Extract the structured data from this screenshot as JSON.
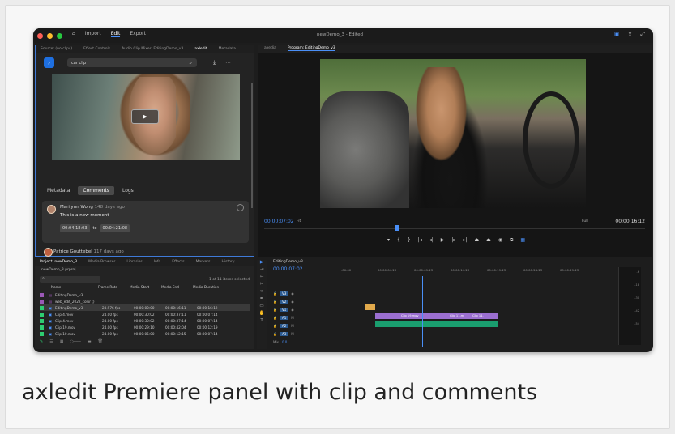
{
  "caption": "axledit Premiere panel with clip and comments",
  "titlebar": {
    "menu": [
      "Import",
      "Edit",
      "Export"
    ],
    "active_menu": "Edit",
    "doc_title": "newDemo_3 - Edited"
  },
  "left_panel": {
    "tabs": [
      "Source: (no clips)",
      "Effect Controls",
      "Audio Clip Mixer: EditingDemo_v3",
      "axledit",
      "Metadata"
    ],
    "active_tab": "axledit",
    "search_value": "car clip",
    "sub_tabs": [
      "Metadata",
      "Comments",
      "Logs"
    ],
    "active_sub_tab": "Comments",
    "comment": {
      "author": "Marilynn Wong",
      "age": "148 days ago",
      "text": "This is a new moment",
      "time_start": "00:04:18:03",
      "time_sep": "to",
      "time_end": "00:04:21:08"
    },
    "comment2": {
      "author": "Patrice Gouttebel",
      "age": "117 days ago"
    }
  },
  "program_panel": {
    "tabs": [
      "axedia",
      "Program: EditingDemo_v3"
    ],
    "active_tab": "Program: EditingDemo_v3",
    "timecode": "00:00:07:02",
    "fit": "Fit",
    "quality": "Full",
    "duration": "00:00:16:12"
  },
  "project_panel": {
    "tabs": [
      "Project: newDemo_3",
      "Media Browser",
      "Libraries",
      "Info",
      "Effects",
      "Markers",
      "History"
    ],
    "path": "newDemo_3.prproj",
    "items_selected": "1 of 11 items selected",
    "columns": [
      "Name",
      "Frame Rate",
      "Media Start",
      "Media End",
      "Media Duration"
    ],
    "rows": [
      {
        "name": "EditingDemo_v3",
        "rate": "",
        "start": "",
        "end": "",
        "dur": "",
        "color": "#9b59b6"
      },
      {
        "name": "web_edit_2022_color ()",
        "rate": "",
        "start": "",
        "end": "",
        "dur": "",
        "color": "#9b59b6"
      },
      {
        "name": "EditingDemo_v3",
        "rate": "23.976 fps",
        "start": "00:00:00:00",
        "end": "00:00:16:11",
        "dur": "00:00:16:12",
        "color": "#2ecc71"
      },
      {
        "name": "Clip 4.mov",
        "rate": "24.00 fps",
        "start": "00:00:30:02",
        "end": "00:00:37:11",
        "dur": "00:00:07:14",
        "color": "#2ecc71"
      },
      {
        "name": "Clip 4.mov",
        "rate": "24.00 fps",
        "start": "00:00:30:02",
        "end": "00:00:37:14",
        "dur": "00:00:07:14",
        "color": "#2ecc71"
      },
      {
        "name": "Clip 19.mov",
        "rate": "24.00 fps",
        "start": "00:00:29:10",
        "end": "00:00:42:04",
        "dur": "00:00:12:19",
        "color": "#2ecc71"
      },
      {
        "name": "Clip 10.mov",
        "rate": "24.00 fps",
        "start": "00:00:05:00",
        "end": "00:00:12:15",
        "dur": "00:00:07:14",
        "color": "#2ecc71"
      }
    ]
  },
  "timeline": {
    "tab": "EditingDemo_v3",
    "timecode": "00:00:07:02",
    "ruler": [
      ":00:00",
      "00:00:04:23",
      "00:00:09:23",
      "00:00:14:23",
      "00:00:19:23",
      "00:00:24:23",
      "00:00:29:23"
    ],
    "tracks": [
      "V3",
      "V2",
      "V1",
      "A1",
      "A2",
      "A3"
    ],
    "mix_label": "Mix",
    "mix_value": "0.0",
    "clips_v1": [
      "Clip 19.mov",
      "Clip 11.m",
      "Clip 11."
    ],
    "colors": {
      "video": "#9b6fd0",
      "audio": "#1a9e6f",
      "accent": "#4a8ff7"
    }
  }
}
